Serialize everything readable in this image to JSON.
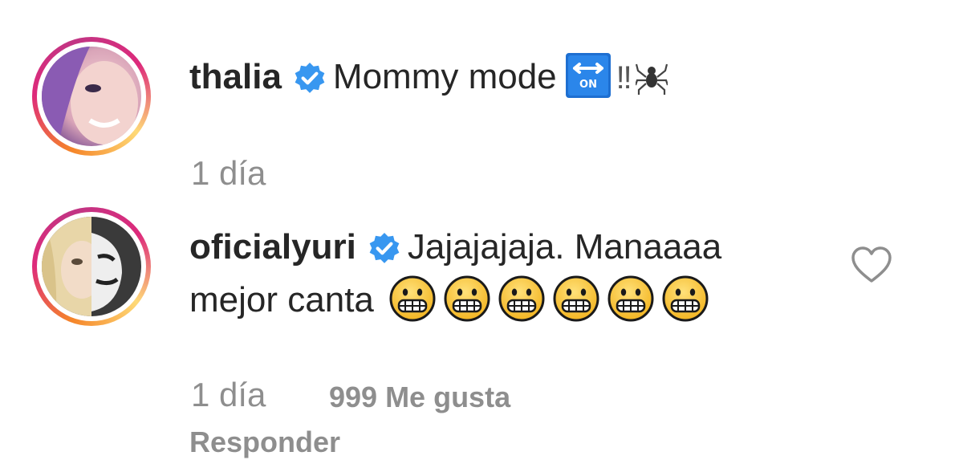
{
  "comments": [
    {
      "username": "thalia",
      "verified": true,
      "text": "Mommy mode",
      "trailing_emoji": [
        "on-arrow-emoji",
        "double-exclamation-emoji",
        "spider-emoji"
      ],
      "trailing_text": "‼",
      "time": "1 día"
    },
    {
      "username": "oficialyuri",
      "verified": true,
      "text_line1": "Jajajajaja. Manaaaa",
      "text_line2": "mejor canta",
      "emoji_count": 6,
      "emoji_name": "grimacing-face-emoji",
      "time": "1 día",
      "likes": "999 Me gusta",
      "reply": "Responder"
    }
  ],
  "colors": {
    "verified_blue": "#3897f0",
    "meta_gray": "#8e8e8e",
    "text_dark": "#262626"
  },
  "icons": {
    "like": "heart-outline-icon"
  }
}
